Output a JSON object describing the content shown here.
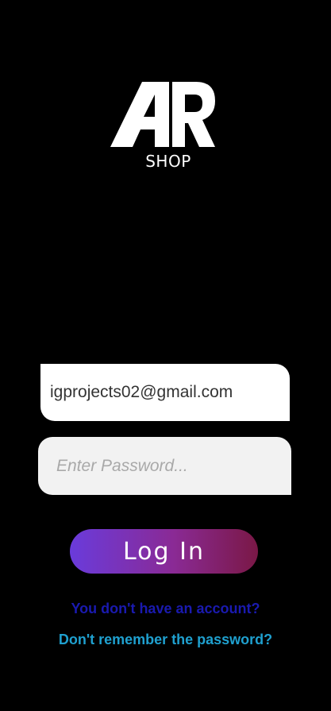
{
  "logo": {
    "mark_text": "AR",
    "subtitle": "SHOP"
  },
  "login_form": {
    "email": {
      "value": "igprojects02@gmail.com"
    },
    "password": {
      "placeholder": "Enter Password..."
    },
    "login_button_label": "Log In",
    "signup_link": "You don't have an account?",
    "forgot_link": "Don't remember the password?"
  },
  "colors": {
    "background": "#000000",
    "button_gradient_start": "#6a3bdb",
    "button_gradient_end": "#7a1846",
    "signup_link": "#1a1ab0",
    "forgot_link": "#1fa0cf"
  }
}
